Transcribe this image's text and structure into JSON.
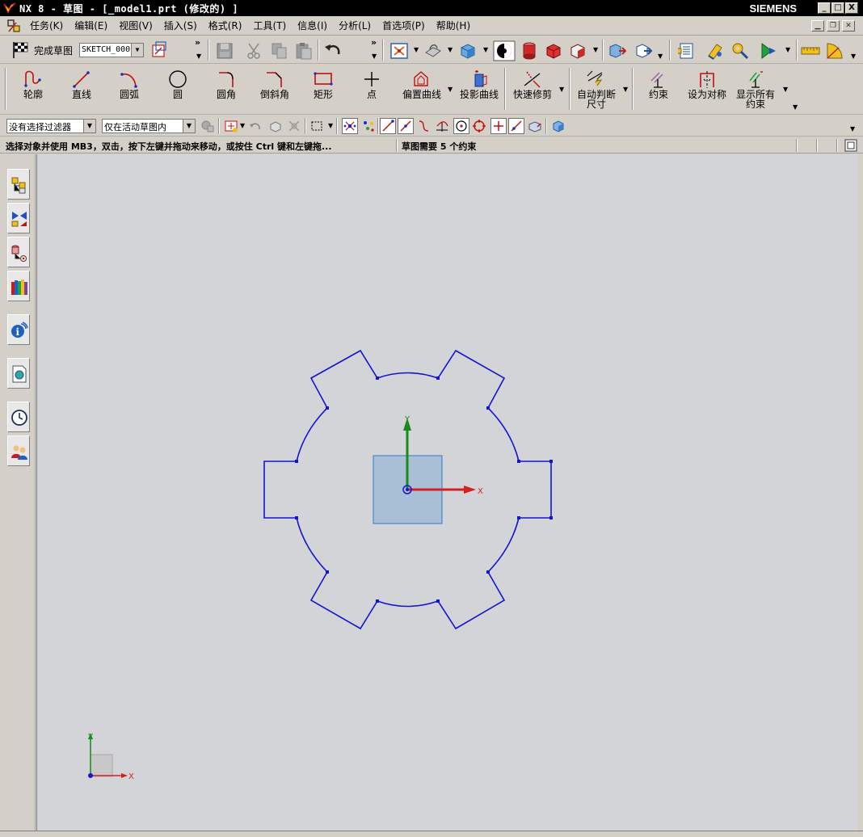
{
  "window": {
    "title": "NX 8 - 草图 - [_model1.prt  (修改的) ]",
    "brand": "SIEMENS",
    "buttons": {
      "minimize": "_",
      "maximize": "□",
      "close": "X"
    }
  },
  "menubar": {
    "items": [
      "任务(K)",
      "编辑(E)",
      "视图(V)",
      "插入(S)",
      "格式(R)",
      "工具(T)",
      "信息(I)",
      "分析(L)",
      "首选项(P)",
      "帮助(H)"
    ]
  },
  "toolbar1": {
    "finish_sketch": "完成草图",
    "sketch_name": "SKETCH_000"
  },
  "sketch_tools": [
    {
      "label": "轮廓",
      "icon": "profile-icon"
    },
    {
      "label": "直线",
      "icon": "line-icon"
    },
    {
      "label": "圆弧",
      "icon": "arc-icon"
    },
    {
      "label": "圆",
      "icon": "circle-icon"
    },
    {
      "label": "圆角",
      "icon": "fillet-icon"
    },
    {
      "label": "倒斜角",
      "icon": "chamfer-icon"
    },
    {
      "label": "矩形",
      "icon": "rectangle-icon"
    },
    {
      "label": "点",
      "icon": "point-icon"
    },
    {
      "label": "偏置曲线",
      "icon": "offset-curve-icon"
    },
    {
      "label": "投影曲线",
      "icon": "project-curve-icon"
    },
    {
      "label": "快速修剪",
      "icon": "quick-trim-icon"
    },
    {
      "label": "自动判断\n尺寸",
      "icon": "inferred-dimension-icon"
    },
    {
      "label": "约束",
      "icon": "constraint-icon"
    },
    {
      "label": "设为对称",
      "icon": "make-symmetric-icon"
    },
    {
      "label": "显示所有\n约束",
      "icon": "show-all-constraints-icon"
    }
  ],
  "filters": {
    "type_filter": "没有选择过滤器",
    "scope_filter": "仅在活动草图内"
  },
  "status": {
    "prompt": "选择对象并使用 MB3，双击，按下左键并拖动来移动，或按住 Ctrl 键和左键拖...",
    "message": "草图需要 5 个约束"
  },
  "axes": {
    "x": "X",
    "y": "Y"
  },
  "colors": {
    "sketch_curve": "#1515d0",
    "x_axis": "#d62020",
    "y_axis": "#1a8a1a",
    "origin_plane": "#88aacc",
    "background": "#d3d4d7"
  }
}
